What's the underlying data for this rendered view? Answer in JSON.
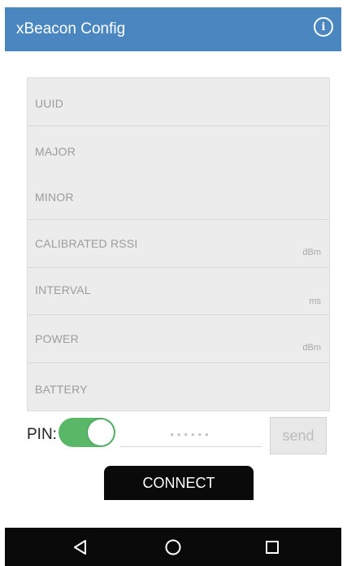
{
  "app": {
    "title": "xBeacon Config",
    "info_icon": "info-icon"
  },
  "form": {
    "fields": [
      {
        "label": "UUID",
        "unit": ""
      },
      {
        "label": "MAJOR",
        "unit": ""
      },
      {
        "label": "MINOR",
        "unit": ""
      },
      {
        "label": "CALIBRATED RSSI",
        "unit": "dBm"
      },
      {
        "label": "INTERVAL",
        "unit": "ms"
      },
      {
        "label": "POWER",
        "unit": "dBm"
      },
      {
        "label": "BATTERY",
        "unit": ""
      }
    ]
  },
  "pin": {
    "label": "PIN:",
    "toggle_on": true,
    "placeholder": "••••••",
    "send_label": "send"
  },
  "actions": {
    "connect_label": "CONNECT"
  },
  "navbar": {
    "back_icon": "back-icon",
    "home_icon": "home-icon",
    "recents_icon": "recents-icon"
  },
  "colors": {
    "appbar": "#4a87c0",
    "toggle": "#58b868",
    "connect": "#0a0a0a"
  }
}
